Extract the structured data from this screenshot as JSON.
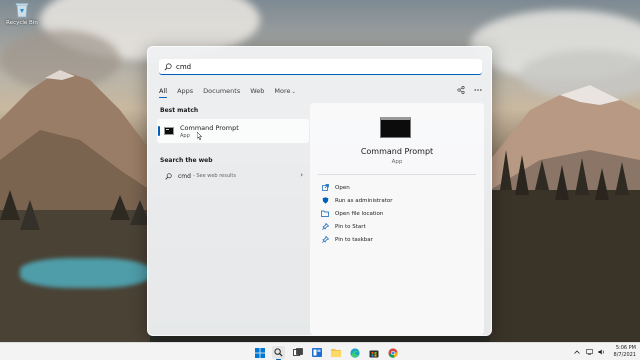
{
  "desktop": {
    "icons": [
      {
        "label": "Recycle Bin",
        "icon": "recycle-bin-icon"
      }
    ]
  },
  "search": {
    "query": "cmd",
    "tabs": [
      {
        "label": "All",
        "active": true
      },
      {
        "label": "Apps",
        "active": false
      },
      {
        "label": "Documents",
        "active": false
      },
      {
        "label": "Web",
        "active": false
      },
      {
        "label": "More",
        "active": false
      }
    ],
    "tools": [
      "share-icon",
      "more-options-icon"
    ],
    "best_match": {
      "section_title": "Best match",
      "name": "Command Prompt",
      "type": "App",
      "icon": "command-prompt-icon"
    },
    "web": {
      "section_title": "Search the web",
      "query": "cmd",
      "suffix": "- See web results"
    },
    "preview": {
      "name": "Command Prompt",
      "type": "App",
      "actions": [
        {
          "label": "Open",
          "icon": "open-icon"
        },
        {
          "label": "Run as administrator",
          "icon": "shield-icon"
        },
        {
          "label": "Open file location",
          "icon": "folder-icon"
        },
        {
          "label": "Pin to Start",
          "icon": "pin-icon"
        },
        {
          "label": "Pin to taskbar",
          "icon": "pin-icon"
        }
      ]
    }
  },
  "taskbar": {
    "apps": [
      {
        "name": "Start",
        "icon": "windows-start-icon"
      },
      {
        "name": "Search",
        "icon": "search-icon",
        "active": true
      },
      {
        "name": "Task View",
        "icon": "task-view-icon"
      },
      {
        "name": "Widgets",
        "icon": "widgets-icon"
      },
      {
        "name": "File Explorer",
        "icon": "file-explorer-icon"
      },
      {
        "name": "Microsoft Edge",
        "icon": "edge-icon"
      },
      {
        "name": "Microsoft Store",
        "icon": "store-icon"
      },
      {
        "name": "Google Chrome",
        "icon": "chrome-icon"
      }
    ],
    "tray": [
      "chevron-up-icon",
      "network-icon",
      "volume-icon"
    ],
    "time": "5:06 PM",
    "date": "8/7/2021"
  },
  "colors": {
    "accent": "#005fb8",
    "panel_bg": "#eef0f3",
    "taskbar_bg": "#f3f3f3"
  }
}
